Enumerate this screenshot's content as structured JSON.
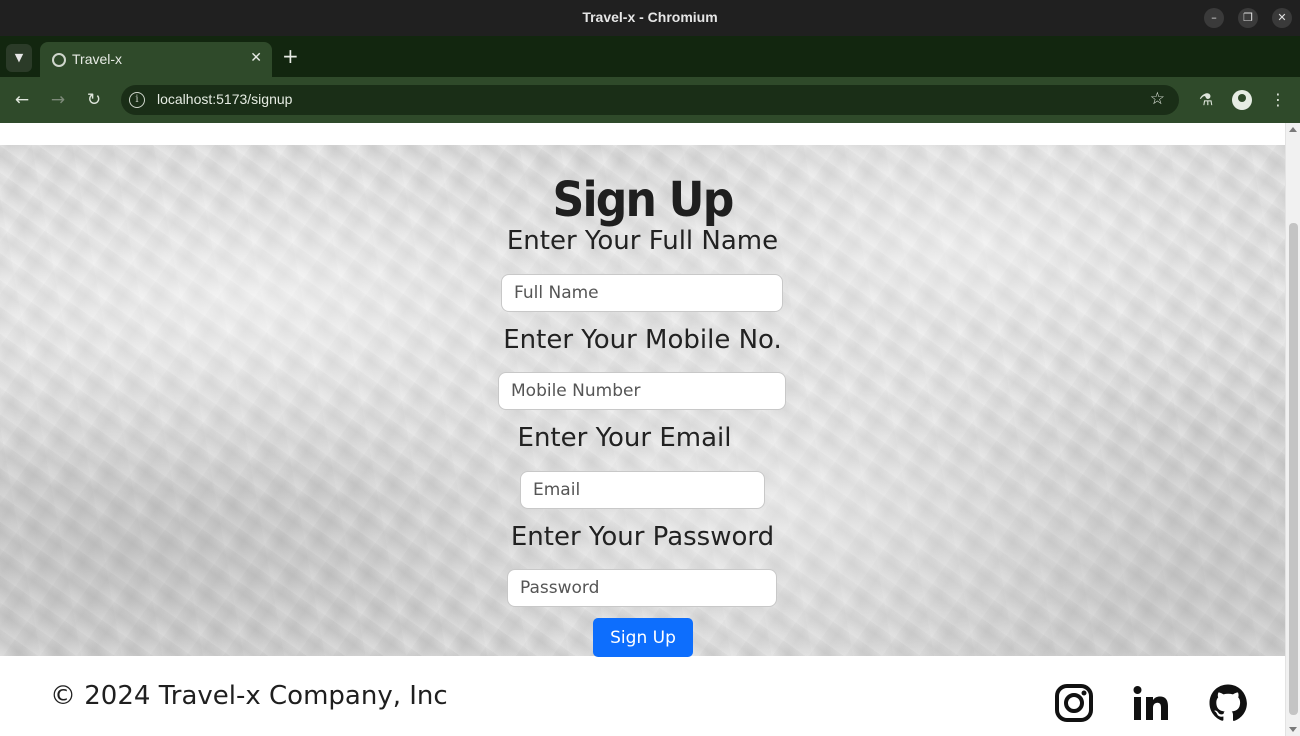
{
  "window": {
    "title": "Travel-x - Chromium",
    "minimize_icon": "minimize-icon",
    "restore_icon": "restore-icon",
    "close_icon": "close-icon"
  },
  "tabs": [
    {
      "title": "Travel-x",
      "favicon": "globe-icon",
      "active": true
    }
  ],
  "toolbar": {
    "url": "localhost:5173/signup",
    "back_icon": "back-arrow-icon",
    "forward_icon": "forward-arrow-icon",
    "reload_icon": "reload-icon",
    "bookmark_icon": "star-icon",
    "labs_icon": "flask-icon",
    "profile_icon": "profile-icon",
    "menu_icon": "kebab-menu-icon"
  },
  "page": {
    "heading": "Sign Up",
    "fields": [
      {
        "label": "Enter Your Full Name",
        "placeholder": "Full Name",
        "value": ""
      },
      {
        "label": "Enter Your Mobile No.",
        "placeholder": "Mobile Number",
        "value": ""
      },
      {
        "label": "Enter Your Email",
        "placeholder": "Email",
        "value": ""
      },
      {
        "label": "Enter Your Password",
        "placeholder": "Password",
        "value": ""
      }
    ],
    "submit_label": "Sign Up",
    "accent_color": "#0d6efd"
  },
  "footer": {
    "copyright": "© 2024 Travel-x Company, Inc",
    "social": [
      "instagram-icon",
      "linkedin-icon",
      "github-icon"
    ]
  }
}
